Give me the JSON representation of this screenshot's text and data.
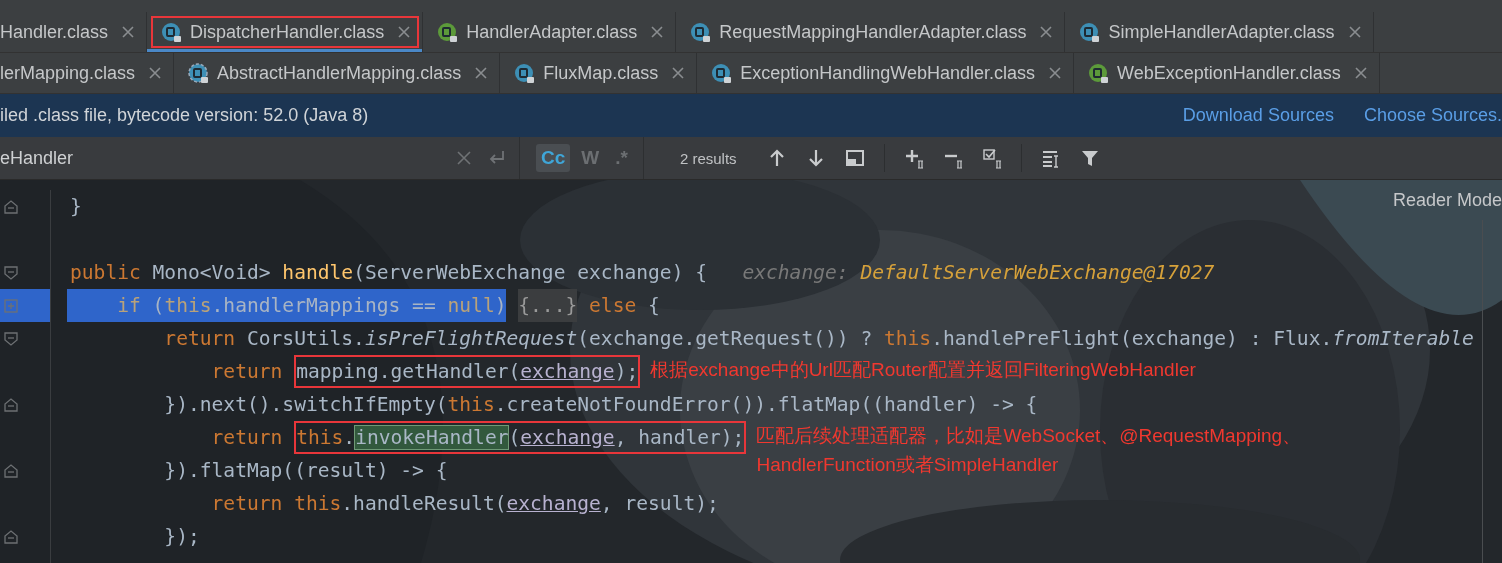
{
  "tab_rows": [
    {
      "tabs": [
        {
          "label": "Handler.class",
          "kind": "plain",
          "selected": false,
          "outlined": false
        },
        {
          "label": "DispatcherHandler.class",
          "kind": "class",
          "selected": true,
          "outlined": true
        },
        {
          "label": "HandlerAdapter.class",
          "kind": "interface",
          "selected": false,
          "outlined": false
        },
        {
          "label": "RequestMappingHandlerAdapter.class",
          "kind": "class",
          "selected": false,
          "outlined": false
        },
        {
          "label": "SimpleHandlerAdapter.class",
          "kind": "class",
          "selected": false,
          "outlined": false
        }
      ]
    },
    {
      "tabs": [
        {
          "label": "lerMapping.class",
          "kind": "plain",
          "selected": false,
          "outlined": false
        },
        {
          "label": "AbstractHandlerMapping.class",
          "kind": "abstract",
          "selected": false,
          "outlined": false
        },
        {
          "label": "FluxMap.class",
          "kind": "class",
          "selected": false,
          "outlined": false
        },
        {
          "label": "ExceptionHandlingWebHandler.class",
          "kind": "class",
          "selected": false,
          "outlined": false
        },
        {
          "label": "WebExceptionHandler.class",
          "kind": "interface",
          "selected": false,
          "outlined": false
        }
      ]
    }
  ],
  "notice_bar": {
    "message": "iled .class file, bytecode version: 52.0 (Java 8)",
    "links": [
      "Download Sources",
      "Choose Sources."
    ]
  },
  "search_bar": {
    "value": "eHandler",
    "toggles": [
      {
        "label": "Cc",
        "selected": true
      },
      {
        "label": "W",
        "selected": false
      },
      {
        "label": ".*",
        "selected": false
      }
    ],
    "results": "2 results"
  },
  "editor": {
    "reader_mode": "Reader Mode",
    "lines": [
      {
        "selected": false,
        "kind": "fold-end",
        "parts": [
          {
            "kind": "plain",
            "text": "}"
          }
        ]
      },
      {
        "selected": false,
        "kind": "plain"
      },
      {
        "selected": false,
        "kind": "fold-start",
        "parts": [
          {
            "kind": "keyword",
            "text": "public "
          },
          {
            "kind": "plain",
            "text": "Mono<Void> "
          },
          {
            "kind": "method",
            "text": "handle"
          },
          {
            "kind": "plain",
            "text": "(ServerWebExchange exchange) {   "
          },
          {
            "kind": "hint-label",
            "text": "exchange: "
          },
          {
            "kind": "hint-value",
            "text": "DefaultServerWebExchange@17027"
          }
        ]
      },
      {
        "selected": true,
        "kind": "fold-collapsed",
        "parts": [
          {
            "kind": "selection",
            "parts": [
              {
                "kind": "keyword",
                "text": "    if "
              },
              {
                "kind": "plain",
                "text": "("
              },
              {
                "kind": "keyword",
                "text": "this"
              },
              {
                "kind": "plain",
                "text": "."
              },
              {
                "kind": "field",
                "text": "handlerMappings"
              },
              {
                "kind": "plain",
                "text": " == "
              },
              {
                "kind": "keyword",
                "text": "null"
              },
              {
                "kind": "plain",
                "text": ")"
              }
            ]
          },
          {
            "kind": "folded",
            "text": "{...}"
          },
          {
            "kind": "keyword",
            "text": " else"
          },
          {
            "kind": "plain",
            "text": " {"
          }
        ]
      },
      {
        "selected": false,
        "kind": "fold-start",
        "parts": [
          {
            "kind": "keyword",
            "text": "        return "
          },
          {
            "kind": "plain",
            "text": "CorsUtils."
          },
          {
            "kind": "static",
            "text": "isPreFlightRequest"
          },
          {
            "kind": "plain",
            "text": "(exchange.getRequest()) ? "
          },
          {
            "kind": "keyword",
            "text": "this"
          },
          {
            "kind": "plain",
            "text": ".handlePreFlight(exchange) : Flux."
          },
          {
            "kind": "static",
            "text": "fromIterable"
          }
        ]
      },
      {
        "selected": false,
        "kind": "plain",
        "parts": [
          {
            "kind": "keyword",
            "text": "            return "
          },
          {
            "kind": "outline",
            "parts": [
              {
                "kind": "plain",
                "text": "mapping.getHandler("
              },
              {
                "kind": "param",
                "text": "exchange"
              },
              {
                "kind": "plain",
                "text": ");"
              }
            ]
          }
        ],
        "annotation": "根据exchange中的Url匹配Router配置并返回FilteringWebHandler"
      },
      {
        "selected": false,
        "kind": "fold-end",
        "parts": [
          {
            "kind": "plain",
            "text": "        }).next().switchIfEmpty("
          },
          {
            "kind": "keyword",
            "text": "this"
          },
          {
            "kind": "plain",
            "text": ".createNotFoundError()).flatMap((handler) -> {"
          }
        ]
      },
      {
        "selected": false,
        "kind": "plain",
        "parts": [
          {
            "kind": "keyword",
            "text": "            return "
          },
          {
            "kind": "outline",
            "parts": [
              {
                "kind": "keyword",
                "text": "this"
              },
              {
                "kind": "plain",
                "text": "."
              },
              {
                "kind": "match",
                "text": "invokeHandler"
              },
              {
                "kind": "plain",
                "text": "("
              },
              {
                "kind": "param",
                "text": "exchange"
              },
              {
                "kind": "plain",
                "text": ", handler);"
              }
            ]
          }
        ],
        "annotation": "匹配后续处理适配器，比如是WebSocket、@RequestMapping、HandlerFunction或者SimpleHandler"
      },
      {
        "selected": false,
        "kind": "fold-end",
        "parts": [
          {
            "kind": "plain",
            "text": "        }).flatMap((result) -> {"
          }
        ]
      },
      {
        "selected": false,
        "kind": "plain",
        "parts": [
          {
            "kind": "keyword",
            "text": "            return this"
          },
          {
            "kind": "plain",
            "text": ".handleResult("
          },
          {
            "kind": "param",
            "text": "exchange"
          },
          {
            "kind": "plain",
            "text": ", result);"
          }
        ]
      },
      {
        "selected": false,
        "kind": "fold-end",
        "parts": [
          {
            "kind": "plain",
            "text": "        });"
          }
        ]
      }
    ]
  }
}
